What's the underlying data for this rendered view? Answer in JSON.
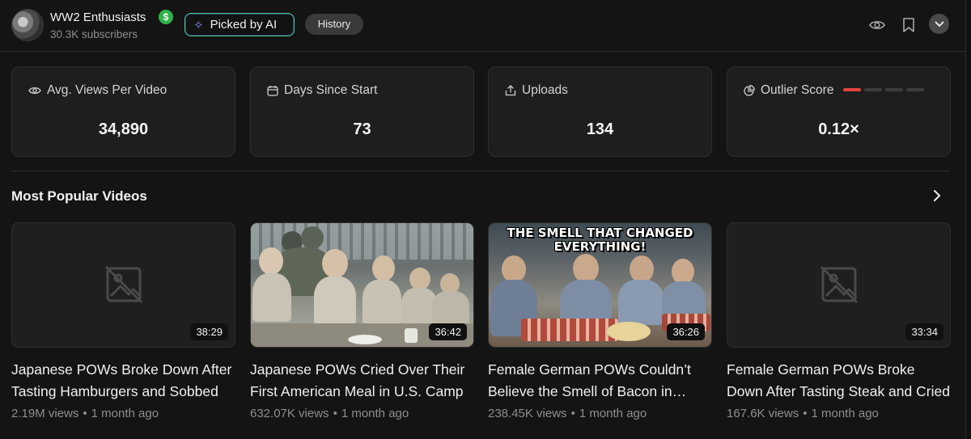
{
  "header": {
    "channel_name": "WW2 Enthusiasts",
    "subscribers": "30.3K subscribers",
    "picked_label": "Picked by AI",
    "history_label": "History",
    "icons": [
      "eye-icon",
      "bookmark-icon",
      "chevron-down-icon"
    ]
  },
  "stats": [
    {
      "label": "Avg. Views Per Video",
      "value": "34,890",
      "icon": "eye-icon"
    },
    {
      "label": "Days Since Start",
      "value": "73",
      "icon": "calendar-icon"
    },
    {
      "label": "Uploads",
      "value": "134",
      "icon": "upload-icon"
    },
    {
      "label": "Outlier Score",
      "value": "0.12×",
      "icon": "pie-chart-icon",
      "level": 0.25,
      "accent": "#e0443e"
    }
  ],
  "section": {
    "title": "Most Popular Videos"
  },
  "videos": [
    {
      "title": "Japanese POWs Broke Down After Tasting Hamburgers and Sobbed",
      "duration": "38:29",
      "views": "2.19M views",
      "age": "1 month ago",
      "thumbnail": "none"
    },
    {
      "title": "Japanese POWs Cried Over Their First American Meal in U.S. Camp",
      "duration": "36:42",
      "views": "632.07K views",
      "age": "1 month ago",
      "thumbnail": "image"
    },
    {
      "title": "Female German POWs Couldn’t Believe the Smell of Bacon in Camp",
      "duration": "36:26",
      "views": "238.45K views",
      "age": "1 month ago",
      "thumbnail": "image",
      "thumb_text": "THE SMELL THAT CHANGED EVERYTHING!"
    },
    {
      "title": "Female German POWs Broke Down After Tasting Steak and Cried",
      "duration": "33:34",
      "views": "167.6K views",
      "age": "1 month ago",
      "thumbnail": "none"
    }
  ],
  "meta_separator": "•",
  "colors": {
    "background": "#141414",
    "card": "#1e1e1e",
    "verified": "#2fb34a",
    "picked_border": "#4ad08a"
  }
}
